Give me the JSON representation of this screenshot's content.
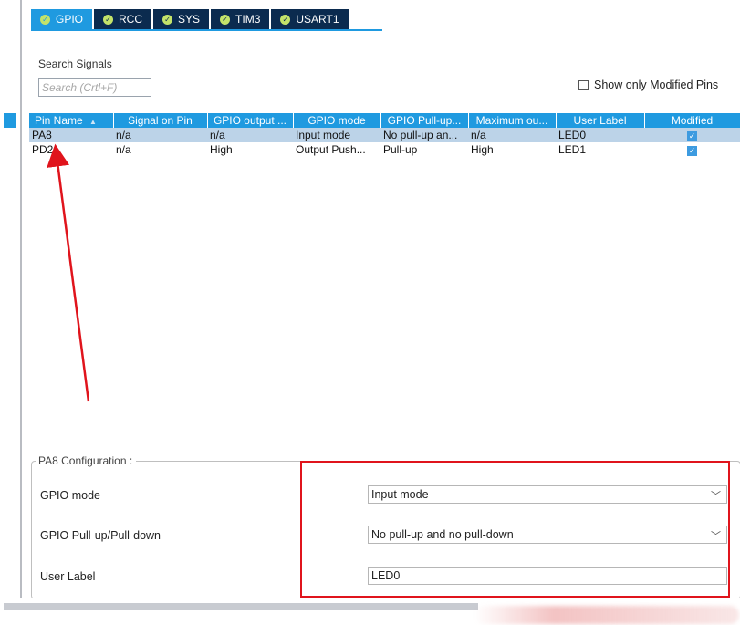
{
  "tabs": [
    {
      "label": "GPIO",
      "active": true
    },
    {
      "label": "RCC",
      "active": false
    },
    {
      "label": "SYS",
      "active": false
    },
    {
      "label": "TIM3",
      "active": false
    },
    {
      "label": "USART1",
      "active": false
    }
  ],
  "search": {
    "label": "Search Signals",
    "placeholder": "Search (Crtl+F)",
    "value": ""
  },
  "filter": {
    "show_modified_label": "Show only Modified Pins",
    "checked": false
  },
  "table": {
    "columns": [
      "Pin Name",
      "Signal on Pin",
      "GPIO output ...",
      "GPIO mode",
      "GPIO Pull-up...",
      "Maximum ou...",
      "User Label",
      "Modified"
    ],
    "sort_indicator": "▲",
    "rows": [
      {
        "pin": "PA8",
        "signal": "n/a",
        "output": "n/a",
        "mode": "Input mode",
        "pull": "No pull-up an...",
        "max": "n/a",
        "label": "LED0",
        "modified": true,
        "selected": true
      },
      {
        "pin": "PD2",
        "signal": "n/a",
        "output": "High",
        "mode": "Output Push...",
        "pull": "Pull-up",
        "max": "High",
        "label": "LED1",
        "modified": true,
        "selected": false
      }
    ]
  },
  "config": {
    "title": "PA8 Configuration :",
    "gpio_mode_label": "GPIO mode",
    "gpio_mode_value": "Input mode",
    "pull_label": "GPIO Pull-up/Pull-down",
    "pull_value": "No pull-up and no pull-down",
    "user_label_label": "User Label",
    "user_label_value": "LED0"
  },
  "colors": {
    "tab_active": "#1f9ae0",
    "tab_inactive": "#0b2b4f",
    "annotation": "#e0141c"
  },
  "icons": {
    "tab_status": "check-circle-icon",
    "modified": "checkbox-checked-icon",
    "dropdown": "chevron-down-icon"
  }
}
